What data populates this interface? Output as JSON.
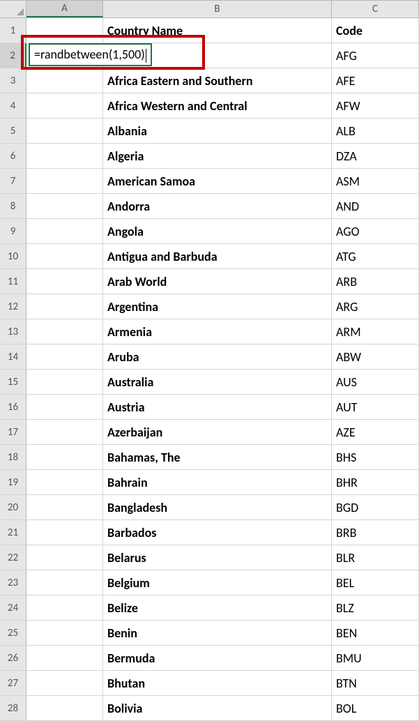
{
  "columns": {
    "a": "A",
    "b": "B",
    "c": "C"
  },
  "headers": {
    "b": "Country Name",
    "c": "Code"
  },
  "formula": "=randbetween(1,500)",
  "rows": [
    {
      "n": "1"
    },
    {
      "n": "2",
      "b": "",
      "c": "AFG"
    },
    {
      "n": "3",
      "b": "Africa Eastern and Southern",
      "c": "AFE"
    },
    {
      "n": "4",
      "b": "Africa Western and Central",
      "c": "AFW"
    },
    {
      "n": "5",
      "b": "Albania",
      "c": "ALB"
    },
    {
      "n": "6",
      "b": "Algeria",
      "c": "DZA"
    },
    {
      "n": "7",
      "b": "American Samoa",
      "c": "ASM"
    },
    {
      "n": "8",
      "b": "Andorra",
      "c": "AND"
    },
    {
      "n": "9",
      "b": "Angola",
      "c": "AGO"
    },
    {
      "n": "10",
      "b": "Antigua and Barbuda",
      "c": "ATG"
    },
    {
      "n": "11",
      "b": "Arab World",
      "c": "ARB"
    },
    {
      "n": "12",
      "b": "Argentina",
      "c": "ARG"
    },
    {
      "n": "13",
      "b": "Armenia",
      "c": "ARM"
    },
    {
      "n": "14",
      "b": "Aruba",
      "c": "ABW"
    },
    {
      "n": "15",
      "b": "Australia",
      "c": "AUS"
    },
    {
      "n": "16",
      "b": "Austria",
      "c": "AUT"
    },
    {
      "n": "17",
      "b": "Azerbaijan",
      "c": "AZE"
    },
    {
      "n": "18",
      "b": "Bahamas, The",
      "c": "BHS"
    },
    {
      "n": "19",
      "b": "Bahrain",
      "c": "BHR"
    },
    {
      "n": "20",
      "b": "Bangladesh",
      "c": "BGD"
    },
    {
      "n": "21",
      "b": "Barbados",
      "c": "BRB"
    },
    {
      "n": "22",
      "b": "Belarus",
      "c": "BLR"
    },
    {
      "n": "23",
      "b": "Belgium",
      "c": "BEL"
    },
    {
      "n": "24",
      "b": "Belize",
      "c": "BLZ"
    },
    {
      "n": "25",
      "b": "Benin",
      "c": "BEN"
    },
    {
      "n": "26",
      "b": "Bermuda",
      "c": "BMU"
    },
    {
      "n": "27",
      "b": "Bhutan",
      "c": "BTN"
    },
    {
      "n": "28",
      "b": "Bolivia",
      "c": "BOL"
    }
  ]
}
